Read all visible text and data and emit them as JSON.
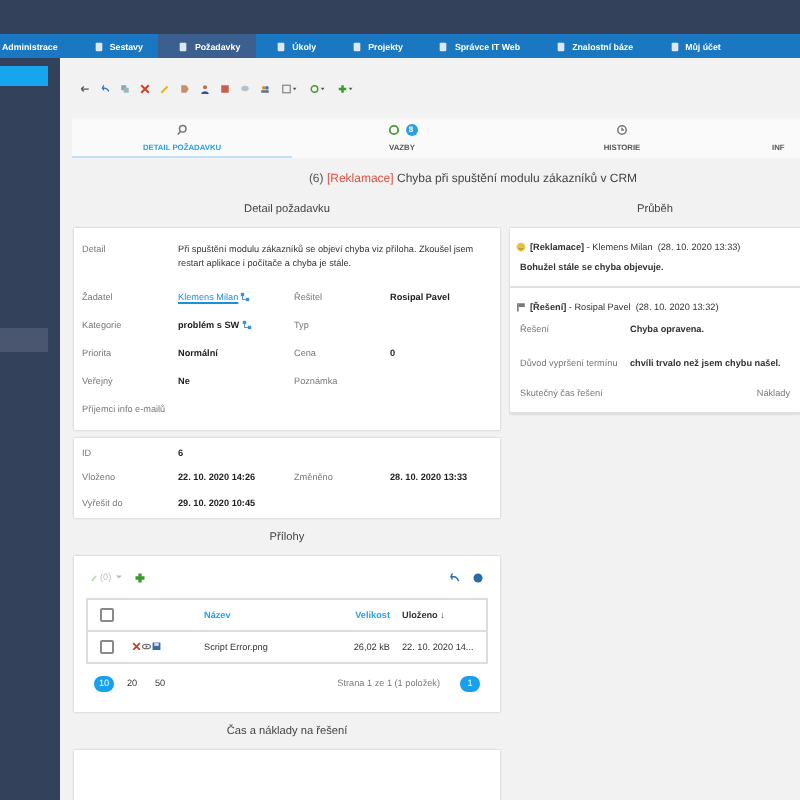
{
  "nav": [
    {
      "label": "Administrace",
      "selected": false
    },
    {
      "label": "Sestavy",
      "selected": false
    },
    {
      "label": "Požadavky",
      "selected": true
    },
    {
      "label": "Úkoly",
      "selected": false
    },
    {
      "label": "Projekty",
      "selected": false
    },
    {
      "label": "Správce IT Web",
      "selected": false
    },
    {
      "label": "Znalostní báze",
      "selected": false
    },
    {
      "label": "Můj účet",
      "selected": false
    }
  ],
  "tabs": [
    {
      "label": "DETAIL POŽADAVKU",
      "selected": true
    },
    {
      "label": "VAZBY",
      "selected": false,
      "badge": "8"
    },
    {
      "label": "HISTORIE",
      "selected": false
    },
    {
      "label": "INF",
      "selected": false
    }
  ],
  "title": {
    "number": "(6)",
    "tag": "[Reklamace]",
    "text": "Chyba při spuštění modulu zákazníků v CRM"
  },
  "detail": {
    "heading": "Detail požadavku",
    "description_label": "Detail",
    "description": "Při spuštění modulu zákazníků se objeví chyba viz příloha. Zkoušel jsem restart aplikace i počítače a chyba je stále.",
    "fields": [
      {
        "label": "Žadatel",
        "value": "Klemens Milan",
        "link": true
      },
      {
        "label": "Řešitel",
        "value": "Rosipal Pavel",
        "link": false
      },
      {
        "label": "Kategorie",
        "value": "problém s SW",
        "link": false
      },
      {
        "label": "Typ"
      },
      {
        "label": "Priorita",
        "value": "Normální",
        "link": false
      },
      {
        "label": "Cena",
        "value": "0",
        "link": false
      },
      {
        "label": "Veřejný",
        "value": "Ne",
        "link": false
      },
      {
        "label": "Poznámka"
      }
    ],
    "recipients_label": "Příjemci info e-mailů",
    "meta": [
      [
        {
          "label": "ID",
          "value": "6"
        }
      ],
      [
        {
          "label": "Vloženo",
          "value": "22. 10. 2020 14:26"
        },
        {
          "label": "Změněno",
          "value": "28. 10. 2020 13:33"
        }
      ],
      [
        {
          "label": "Vyřešit do",
          "value": "29. 10. 2020 10:45"
        }
      ]
    ]
  },
  "progress": {
    "heading": "Průběh",
    "entries": [
      {
        "kind": "comment",
        "tag": "[Reklamace]",
        "author": "- Klemens Milan",
        "time": "(28. 10. 2020 13:33)",
        "text": "Bohužel stále se chyba objevuje."
      },
      {
        "kind": "resolution",
        "tag": "[Řešení]",
        "author": "- Rosipal Pavel",
        "time": "(28. 10. 2020 13:32)",
        "rows": [
          {
            "label": "Řešení",
            "value": "Chyba opravena."
          },
          {
            "label": "Důvod vypršení termínu",
            "value": "chvíli trvalo než jsem chybu našel."
          }
        ],
        "footer_label": "Skutečný čas řešení",
        "footer_right": "Náklady"
      }
    ]
  },
  "attachments": {
    "heading": "Přílohy",
    "count": "(0)",
    "columns": [
      "Název",
      "Velikost",
      "Uloženo ↓"
    ],
    "all_checked": false,
    "rows": [
      {
        "checked": false,
        "name": "Script Error.png",
        "size": "26,02 kB",
        "saved": "22. 10. 2020 14..."
      }
    ],
    "page_sizes": [
      {
        "label": "10",
        "selected": true
      },
      {
        "label": "20",
        "selected": false
      },
      {
        "label": "50",
        "selected": false
      }
    ],
    "summary": "Strana 1 ze 1 (1 položek)",
    "pages": [
      {
        "label": "1",
        "selected": true
      }
    ]
  },
  "costs": {
    "heading": "Čas a náklady na řešení"
  }
}
